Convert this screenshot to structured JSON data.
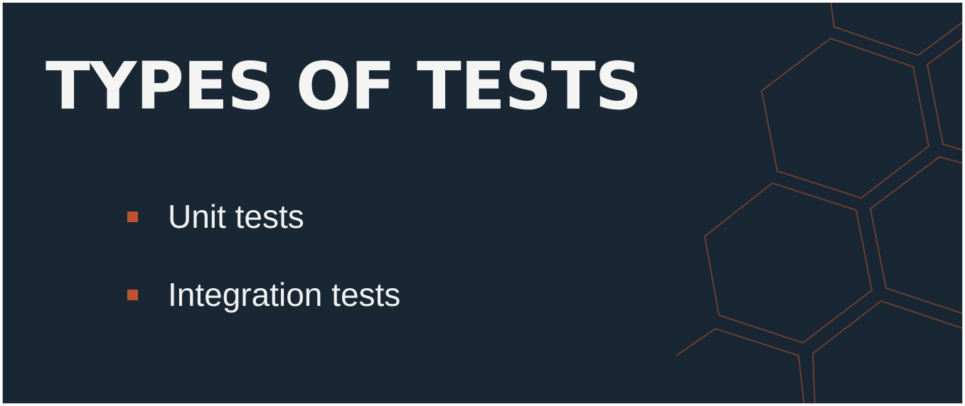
{
  "slide": {
    "title": "TYPES OF TESTS",
    "bullets": [
      {
        "text": "Unit tests"
      },
      {
        "text": "Integration tests"
      }
    ]
  },
  "colors": {
    "background": "#192634",
    "accent": "#c0532e",
    "hex_outline": "#6a3f31",
    "text": "#f4f4f2"
  }
}
